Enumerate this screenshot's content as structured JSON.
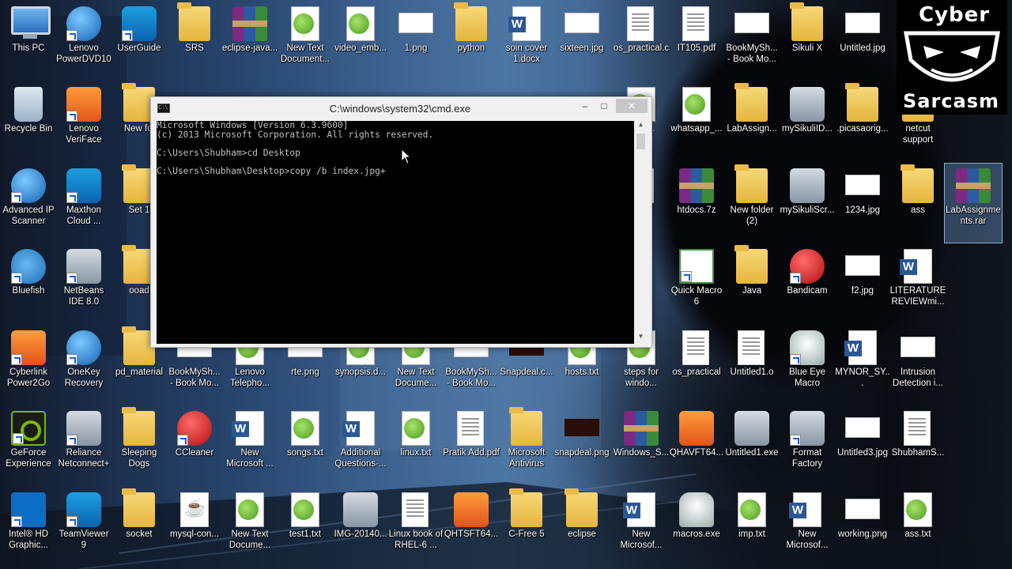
{
  "logo": {
    "top": "Cyber",
    "bottom": "Sarcasm"
  },
  "cmd": {
    "title": "C:\\windows\\system32\\cmd.exe",
    "lines": [
      "Microsoft Windows [Version 6.3.9600]",
      "(c) 2013 Microsoft Corporation. All rights reserved.",
      "",
      "C:\\Users\\Shubham>cd Desktop",
      "",
      "C:\\Users\\Shubham\\Desktop>copy /b index.jpg+"
    ],
    "min_label": "–",
    "max_label": "□",
    "close_label": "✕"
  },
  "desktop_icons": [
    {
      "label": "This PC",
      "icon": "this-pc-icon",
      "type": "pc"
    },
    {
      "label": "Lenovo PowerDVD10",
      "icon": "powerdvd-icon",
      "type": "round t-blue",
      "sc": true
    },
    {
      "label": "UserGuide",
      "icon": "userguide-icon",
      "type": "teal",
      "sc": true
    },
    {
      "label": "SRS",
      "icon": "folder-icon",
      "type": "folder"
    },
    {
      "label": "eclipse-java...",
      "icon": "winrar-icon",
      "type": "rar"
    },
    {
      "label": "New Text Document...",
      "icon": "text-file-icon",
      "type": "txt"
    },
    {
      "label": "video_emb...",
      "icon": "text-file-icon",
      "type": "txt"
    },
    {
      "label": "1.png",
      "icon": "image-file-icon",
      "type": "img"
    },
    {
      "label": "python",
      "icon": "folder-icon",
      "type": "folder"
    },
    {
      "label": "soin cover 1.docx",
      "icon": "word-doc-icon",
      "type": "word"
    },
    {
      "label": "sixteen.jpg",
      "icon": "image-file-icon",
      "type": "img"
    },
    {
      "label": "os_practical.c",
      "icon": "c-file-icon",
      "type": "doc"
    },
    {
      "label": "IT105.pdf",
      "icon": "pdf-file-icon",
      "type": "doc"
    },
    {
      "label": "BookMySh... - Book Mo...",
      "icon": "image-file-icon",
      "type": "img"
    },
    {
      "label": "Sikuli X",
      "icon": "folder-icon",
      "type": "folder"
    },
    {
      "label": "Untitled.jpg",
      "icon": "image-file-icon",
      "type": "img"
    },
    {
      "label": "Recycle Bin",
      "icon": "recycle-bin-icon",
      "type": "recycle"
    },
    {
      "label": "Lenovo VeriFace",
      "icon": "veriface-icon",
      "type": "round t-orange",
      "sc": true
    },
    {
      "label": "New fol",
      "icon": "folder-icon",
      "type": "folder"
    },
    {
      "label": "ry of ...",
      "icon": "text-file-icon",
      "type": "txt"
    },
    {
      "label": "whatsapp_...",
      "icon": "text-file-icon",
      "type": "txt"
    },
    {
      "label": "LabAssign...",
      "icon": "folder-icon",
      "type": "folder"
    },
    {
      "label": "mySikuliID...",
      "icon": "sikuli-icon",
      "type": "gray"
    },
    {
      "label": ".picasaorig...",
      "icon": "folder-icon",
      "type": "folder"
    },
    {
      "label": "netcut support",
      "icon": "folder-icon",
      "type": "folder"
    },
    {
      "label": "Advanced IP Scanner",
      "icon": "ip-scanner-icon",
      "type": "round t-blue",
      "sc": true
    },
    {
      "label": "Maxthon Cloud ...",
      "icon": "maxthon-icon",
      "type": "teal",
      "sc": true
    },
    {
      "label": "Set 1",
      "icon": "folder-icon",
      "type": "folder"
    },
    {
      "label": "1.c",
      "icon": "c-file-icon",
      "type": "doc"
    },
    {
      "label": "htdocs.7z",
      "icon": "winrar-icon",
      "type": "rar"
    },
    {
      "label": "New folder (2)",
      "icon": "folder-icon",
      "type": "folder"
    },
    {
      "label": "mySikuliScr...",
      "icon": "sikuli-icon",
      "type": "gray"
    },
    {
      "label": "1234.jpg",
      "icon": "image-file-icon",
      "type": "img"
    },
    {
      "label": "ass",
      "icon": "folder-icon",
      "type": "folder"
    },
    {
      "label": "LabAssignments.rar",
      "icon": "winrar-icon",
      "type": "rar",
      "sel": true
    },
    {
      "label": "Bluefish",
      "icon": "bluefish-icon",
      "type": "fish",
      "sc": true
    },
    {
      "label": "NetBeans IDE 8.0",
      "icon": "netbeans-icon",
      "type": "gray",
      "sc": true
    },
    {
      "label": "ooad",
      "icon": "folder-icon",
      "type": "folder"
    },
    {
      "label": "Quick Macro 6",
      "icon": "quick-macro-icon",
      "type": "macro",
      "sc": true
    },
    {
      "label": "Java",
      "icon": "folder-icon",
      "type": "folder"
    },
    {
      "label": "Bandicam",
      "icon": "bandicam-icon",
      "type": "red",
      "sc": true
    },
    {
      "label": "f2.jpg",
      "icon": "image-file-icon",
      "type": "img"
    },
    {
      "label": "LITERATURE REVIEWmi...",
      "icon": "word-doc-icon",
      "type": "word"
    },
    {
      "label": "Cyberlink Power2Go",
      "icon": "power2go-icon",
      "type": "orange",
      "sc": true
    },
    {
      "label": "OneKey Recovery",
      "icon": "onekey-icon",
      "type": "round t-blue",
      "sc": true
    },
    {
      "label": "pd_material",
      "icon": "folder-icon",
      "type": "folder"
    },
    {
      "label": "BookMySh... - Book Mo...",
      "icon": "image-file-icon",
      "type": "img"
    },
    {
      "label": "Lenovo Telepho...",
      "icon": "text-file-icon",
      "type": "txt"
    },
    {
      "label": "rte.png",
      "icon": "image-file-icon",
      "type": "img"
    },
    {
      "label": "synopsis.d...",
      "icon": "text-file-icon",
      "type": "txt"
    },
    {
      "label": "New Text Docume...",
      "icon": "text-file-icon",
      "type": "txt"
    },
    {
      "label": "BookMySh... - Book Mo...",
      "icon": "image-file-icon",
      "type": "img"
    },
    {
      "label": "Snapdeal.c...",
      "icon": "image-file-icon",
      "type": "dark"
    },
    {
      "label": "hosts.txt",
      "icon": "text-file-icon",
      "type": "txt"
    },
    {
      "label": "steps for windo...",
      "icon": "text-file-icon",
      "type": "txt"
    },
    {
      "label": "os_practical",
      "icon": "document-icon",
      "type": "doc"
    },
    {
      "label": "Untitled1.o",
      "icon": "document-icon",
      "type": "doc"
    },
    {
      "label": "Blue Eye Macro",
      "icon": "robot-icon",
      "type": "robot",
      "sc": true
    },
    {
      "label": "MYNOR_SY...",
      "icon": "word-doc-icon",
      "type": "word"
    },
    {
      "label": "Intrusion Detection i...",
      "icon": "image-file-icon",
      "type": "img"
    },
    {
      "label": "GeForce Experience",
      "icon": "geforce-icon",
      "type": "nvidia",
      "sc": true
    },
    {
      "label": "Reliance Netconnect+",
      "icon": "reliance-icon",
      "type": "gray",
      "sc": true
    },
    {
      "label": "Sleeping Dogs",
      "icon": "folder-icon",
      "type": "folder"
    },
    {
      "label": "CCleaner",
      "icon": "ccleaner-icon",
      "type": "red",
      "sc": true
    },
    {
      "label": "New Microsoft ...",
      "icon": "word-doc-icon",
      "type": "word"
    },
    {
      "label": "songs.txt",
      "icon": "text-file-icon",
      "type": "txt"
    },
    {
      "label": "Additional Questions-...",
      "icon": "word-doc-icon",
      "type": "word"
    },
    {
      "label": "linux.txt",
      "icon": "text-file-icon",
      "type": "txt"
    },
    {
      "label": "Pratik Add.pdf",
      "icon": "pdf-file-icon",
      "type": "doc"
    },
    {
      "label": "Microsoft Antivirus",
      "icon": "folder-icon",
      "type": "folder"
    },
    {
      "label": "snapdeal.png",
      "icon": "image-file-icon",
      "type": "dark"
    },
    {
      "label": "Windows_S...",
      "icon": "winrar-icon",
      "type": "rar"
    },
    {
      "label": "QHAVFT64...",
      "icon": "qh-installer-icon",
      "type": "orange"
    },
    {
      "label": "Untitled1.exe",
      "icon": "exe-icon",
      "type": "gray"
    },
    {
      "label": "Format Factory",
      "icon": "format-factory-icon",
      "type": "gray",
      "sc": true
    },
    {
      "label": "Untitled3.jpg",
      "icon": "image-file-icon",
      "type": "img"
    },
    {
      "label": "ShubhamS...",
      "icon": "document-icon",
      "type": "doc"
    },
    {
      "label": "Intel® HD Graphic...",
      "icon": "intel-hd-icon",
      "type": "intel",
      "sc": true
    },
    {
      "label": "TeamViewer 9",
      "icon": "teamviewer-icon",
      "type": "teal",
      "sc": true
    },
    {
      "label": "socket",
      "icon": "folder-icon",
      "type": "folder"
    },
    {
      "label": "mysql-con...",
      "icon": "java-file-icon",
      "type": "java"
    },
    {
      "label": "New Text Docume...",
      "icon": "text-file-icon",
      "type": "txt"
    },
    {
      "label": "test1.txt",
      "icon": "text-file-icon",
      "type": "txt"
    },
    {
      "label": "IMG-20140...",
      "icon": "image-file-icon",
      "type": "gray"
    },
    {
      "label": "Linux book of RHEL-6 ...",
      "icon": "document-icon",
      "type": "doc"
    },
    {
      "label": "QHTSFT64...",
      "icon": "qh-installer-icon",
      "type": "orange"
    },
    {
      "label": "C-Free 5",
      "icon": "folder-icon",
      "type": "folder"
    },
    {
      "label": "eclipse",
      "icon": "folder-icon",
      "type": "folder"
    },
    {
      "label": "New Microsof...",
      "icon": "word-doc-icon",
      "type": "word"
    },
    {
      "label": "macros.exe",
      "icon": "robot-icon",
      "type": "robot"
    },
    {
      "label": "imp.txt",
      "icon": "text-file-icon",
      "type": "txt"
    },
    {
      "label": "New Microsof...",
      "icon": "word-doc-icon",
      "type": "word"
    },
    {
      "label": "working.png",
      "icon": "image-file-icon",
      "type": "img"
    },
    {
      "label": "ass.txt",
      "icon": "text-file-icon",
      "type": "txt"
    }
  ]
}
